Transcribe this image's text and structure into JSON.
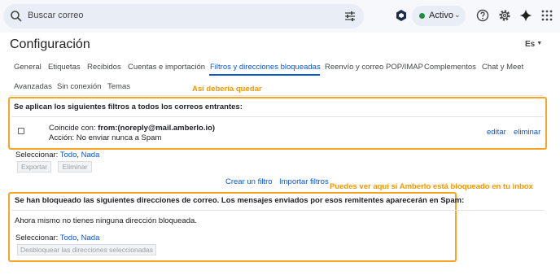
{
  "search": {
    "placeholder": "Buscar correo"
  },
  "status": {
    "label": "Activo"
  },
  "page": {
    "title": "Configuración",
    "language": "Es"
  },
  "tabs": [
    "General",
    "Etiquetas",
    "Recibidos",
    "Cuentas e importación",
    "Filtros y direcciones bloqueadas",
    "Reenvío y correo POP/IMAP",
    "Complementos",
    "Chat y Meet",
    "Avanzadas",
    "Sin conexión",
    "Temas"
  ],
  "annotations": {
    "note1": "Así debería quedar",
    "note2": "Puedes ver aquí si Amberlo está bloqueado en tu inbox"
  },
  "filters": {
    "title": "Se aplican los siguientes filtros a todos los correos entrantes:",
    "rule": {
      "match_prefix": "Coincide con:",
      "match_value": "from:(noreply@mail.amberlo.io)",
      "action": "Acción: No enviar nunca a Spam",
      "edit": "editar",
      "delete": "eliminar"
    },
    "select_label": "Seleccionar:",
    "select_all": "Todo",
    "select_none": "Nada",
    "export": "Exportar",
    "remove": "Eliminar",
    "create": "Crear un filtro",
    "import": "Importar filtros"
  },
  "blocked": {
    "title": "Se han bloqueado las siguientes direcciones de correo. Los mensajes enviados por esos remitentes aparecerán en Spam:",
    "empty": "Ahora mismo no tienes ninguna dirección bloqueada.",
    "select_label": "Seleccionar:",
    "select_all": "Todo",
    "select_none": "Nada",
    "unblock": "Desbloquear las direcciones seleccionadas"
  },
  "colors": {
    "accent": "#0b57d0",
    "highlight": "#f5a623",
    "status_green": "#1e8e3e"
  }
}
